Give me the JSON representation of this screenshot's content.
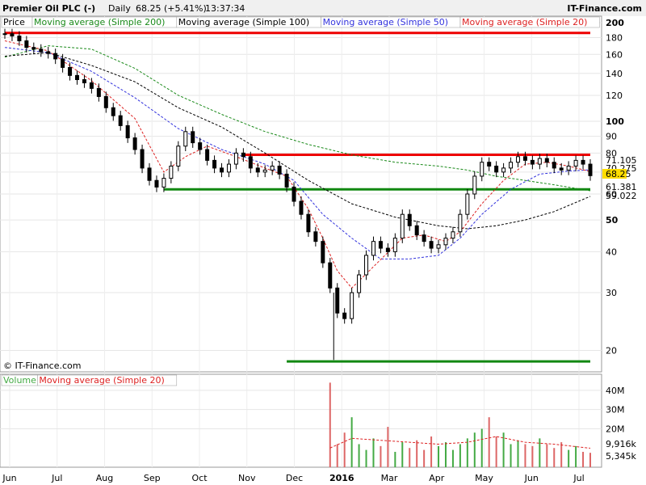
{
  "header": {
    "title": "Premier Oil PLC (-)",
    "interval": "Daily",
    "last_change": "68.25 (+5.41%)",
    "time": "13:37:34",
    "brand": "IT-Finance.com",
    "copyright": "© IT-Finance.com"
  },
  "colors": {
    "price": "#000000",
    "sma200": "#1a8a1a",
    "sma100": "#000000",
    "sma50": "#3333dd",
    "sma20": "#dd2222",
    "resistance": "#ee0000",
    "support": "#118811",
    "volume_up": "#44aa44",
    "volume_down": "#dd6666",
    "volume_ma": "#dd2222"
  },
  "chart_data": [
    {
      "type": "candlestick",
      "scale": "log",
      "ylim": [
        18,
        200
      ],
      "y_ticks": [
        20,
        30,
        40,
        50,
        60,
        70,
        80,
        90,
        100,
        120,
        140,
        160,
        180,
        200
      ],
      "x_ticks": [
        "Jun",
        "Jul",
        "Aug",
        "Sep",
        "Oct",
        "Nov",
        "Dec",
        "2016",
        "Mar",
        "Apr",
        "May",
        "Jun",
        "Jul"
      ],
      "legend": [
        "Price",
        "Moving average (Simple 200)",
        "Moving average (Simple 100)",
        "Moving average (Simple 50)",
        "Moving average (Simple 20)"
      ],
      "last_labels": [
        {
          "name": "Moving average (Simple 50)",
          "value": "71.105",
          "color": "#3333dd"
        },
        {
          "name": "Moving average (Simple 20)",
          "value": "70.275",
          "color": "#dd2222"
        },
        {
          "name": "Price",
          "value": "68.25",
          "color": "#000000",
          "bg": "#ffdd00"
        },
        {
          "name": "Moving average (Simple 200)",
          "value": "61.381",
          "color": "#1a8a1a"
        },
        {
          "name": "Moving average (Simple 100)",
          "value": "59.022",
          "color": "#000000"
        }
      ],
      "price_path": [
        [
          0,
          185
        ],
        [
          1,
          182
        ],
        [
          2,
          176
        ],
        [
          3,
          168
        ],
        [
          4,
          166
        ],
        [
          5,
          163
        ],
        [
          6,
          161
        ],
        [
          7,
          155
        ],
        [
          8,
          146
        ],
        [
          9,
          138
        ],
        [
          10,
          134
        ],
        [
          11,
          131
        ],
        [
          12,
          126
        ],
        [
          13,
          119
        ],
        [
          14,
          110
        ],
        [
          15,
          104
        ],
        [
          16,
          97
        ],
        [
          17,
          89
        ],
        [
          18,
          82
        ],
        [
          19,
          72
        ],
        [
          20,
          66
        ],
        [
          21,
          63
        ],
        [
          22,
          67
        ],
        [
          23,
          73
        ],
        [
          24,
          84
        ],
        [
          25,
          93
        ],
        [
          26,
          86
        ],
        [
          27,
          82
        ],
        [
          28,
          76
        ],
        [
          29,
          72
        ],
        [
          30,
          70
        ],
        [
          31,
          74
        ],
        [
          32,
          80
        ],
        [
          33,
          78
        ],
        [
          34,
          72
        ],
        [
          35,
          70
        ],
        [
          36,
          71
        ],
        [
          37,
          73
        ],
        [
          38,
          69
        ],
        [
          39,
          63
        ],
        [
          40,
          57
        ],
        [
          41,
          52
        ],
        [
          42,
          46
        ],
        [
          43,
          43
        ],
        [
          44,
          37
        ],
        [
          45,
          31
        ],
        [
          46,
          26
        ],
        [
          47,
          25
        ],
        [
          48,
          30
        ],
        [
          49,
          34
        ],
        [
          50,
          39
        ],
        [
          51,
          43
        ],
        [
          52,
          41
        ],
        [
          53,
          40
        ],
        [
          54,
          44
        ],
        [
          55,
          52
        ],
        [
          56,
          48
        ],
        [
          57,
          45
        ],
        [
          58,
          43
        ],
        [
          59,
          41
        ],
        [
          60,
          42
        ],
        [
          61,
          44
        ],
        [
          62,
          46
        ],
        [
          63,
          52
        ],
        [
          64,
          60
        ],
        [
          65,
          68
        ],
        [
          66,
          75
        ],
        [
          67,
          73
        ],
        [
          68,
          70
        ],
        [
          69,
          72
        ],
        [
          70,
          75
        ],
        [
          71,
          78
        ],
        [
          72,
          76
        ],
        [
          73,
          74
        ],
        [
          74,
          77
        ],
        [
          75,
          75
        ],
        [
          76,
          72
        ],
        [
          77,
          71
        ],
        [
          78,
          73
        ],
        [
          79,
          76
        ],
        [
          80,
          74
        ],
        [
          81,
          68.25
        ]
      ],
      "sma200": [
        [
          0,
          157
        ],
        [
          6,
          170
        ],
        [
          12,
          166
        ],
        [
          18,
          145
        ],
        [
          24,
          120
        ],
        [
          30,
          105
        ],
        [
          36,
          93
        ],
        [
          42,
          85
        ],
        [
          48,
          79
        ],
        [
          54,
          75
        ],
        [
          60,
          73
        ],
        [
          64,
          71
        ],
        [
          68,
          68
        ],
        [
          72,
          66
        ],
        [
          76,
          64
        ],
        [
          81,
          61.381
        ]
      ],
      "sma100": [
        [
          0,
          158
        ],
        [
          6,
          162
        ],
        [
          12,
          148
        ],
        [
          18,
          132
        ],
        [
          24,
          110
        ],
        [
          30,
          96
        ],
        [
          36,
          80
        ],
        [
          42,
          66
        ],
        [
          48,
          56
        ],
        [
          54,
          51
        ],
        [
          60,
          48
        ],
        [
          64,
          47
        ],
        [
          68,
          48
        ],
        [
          72,
          50
        ],
        [
          76,
          53
        ],
        [
          81,
          59.022
        ]
      ],
      "sma50": [
        [
          0,
          168
        ],
        [
          6,
          162
        ],
        [
          12,
          142
        ],
        [
          18,
          118
        ],
        [
          24,
          95
        ],
        [
          30,
          82
        ],
        [
          33,
          78
        ],
        [
          36,
          74
        ],
        [
          40,
          66
        ],
        [
          44,
          52
        ],
        [
          48,
          44
        ],
        [
          52,
          38
        ],
        [
          56,
          38
        ],
        [
          60,
          39
        ],
        [
          63,
          44
        ],
        [
          66,
          52
        ],
        [
          70,
          62
        ],
        [
          74,
          69
        ],
        [
          78,
          70.5
        ],
        [
          81,
          71.105
        ]
      ],
      "sma20": [
        [
          0,
          176
        ],
        [
          6,
          164
        ],
        [
          12,
          133
        ],
        [
          18,
          102
        ],
        [
          22,
          70
        ],
        [
          25,
          78
        ],
        [
          28,
          84
        ],
        [
          32,
          78
        ],
        [
          36,
          72
        ],
        [
          39,
          68
        ],
        [
          42,
          54
        ],
        [
          44,
          44
        ],
        [
          46,
          35
        ],
        [
          48,
          31
        ],
        [
          51,
          36
        ],
        [
          55,
          44
        ],
        [
          58,
          45
        ],
        [
          61,
          43
        ],
        [
          63,
          46
        ],
        [
          66,
          56
        ],
        [
          69,
          66
        ],
        [
          72,
          74
        ],
        [
          75,
          75
        ],
        [
          78,
          73
        ],
        [
          81,
          70.275
        ]
      ],
      "levels": [
        {
          "name": "top-resistance",
          "value": 186,
          "from": 0,
          "to": 81,
          "color": "#ee0000"
        },
        {
          "name": "range-resistance",
          "value": 79,
          "from": 33,
          "to": 81,
          "color": "#ee0000"
        },
        {
          "name": "support",
          "value": 62,
          "from": 22,
          "to": 81,
          "color": "#118811"
        },
        {
          "name": "low-support",
          "value": 18.5,
          "from": 39,
          "to": 81,
          "color": "#118811"
        }
      ]
    },
    {
      "type": "bar",
      "legend": [
        "Volume",
        "Moving average (Simple 20)"
      ],
      "y_ticks": [
        "20M",
        "30M",
        "40M"
      ],
      "ylim": [
        0,
        45
      ],
      "last_labels": [
        {
          "name": "Moving average (Simple 20)",
          "value": "9,916k",
          "color": "#dd2222"
        },
        {
          "name": "Volume",
          "value": "5,345k",
          "color": "#1a8a1a"
        }
      ],
      "values": [
        0,
        0,
        0,
        0,
        0,
        0,
        0,
        0,
        0,
        0,
        0,
        0,
        0,
        0,
        0,
        0,
        0,
        0,
        0,
        0,
        0,
        0,
        0,
        0,
        0,
        0,
        0,
        0,
        0,
        0,
        0,
        0,
        0,
        0,
        0,
        0,
        0,
        0,
        0,
        0,
        0,
        0,
        0,
        0,
        0,
        44,
        12,
        18,
        26,
        12,
        9,
        15,
        11,
        21,
        8,
        13,
        10,
        14,
        9,
        16,
        11,
        13,
        9,
        12,
        15,
        18,
        20,
        26,
        16,
        18,
        12,
        14,
        12,
        11,
        15,
        12,
        10,
        13,
        9,
        11,
        8,
        7.5
      ],
      "ma": [
        [
          45,
          10
        ],
        [
          48,
          15
        ],
        [
          52,
          14
        ],
        [
          56,
          13
        ],
        [
          60,
          12
        ],
        [
          64,
          13
        ],
        [
          68,
          16
        ],
        [
          72,
          13
        ],
        [
          76,
          12
        ],
        [
          81,
          9.9
        ]
      ]
    }
  ]
}
